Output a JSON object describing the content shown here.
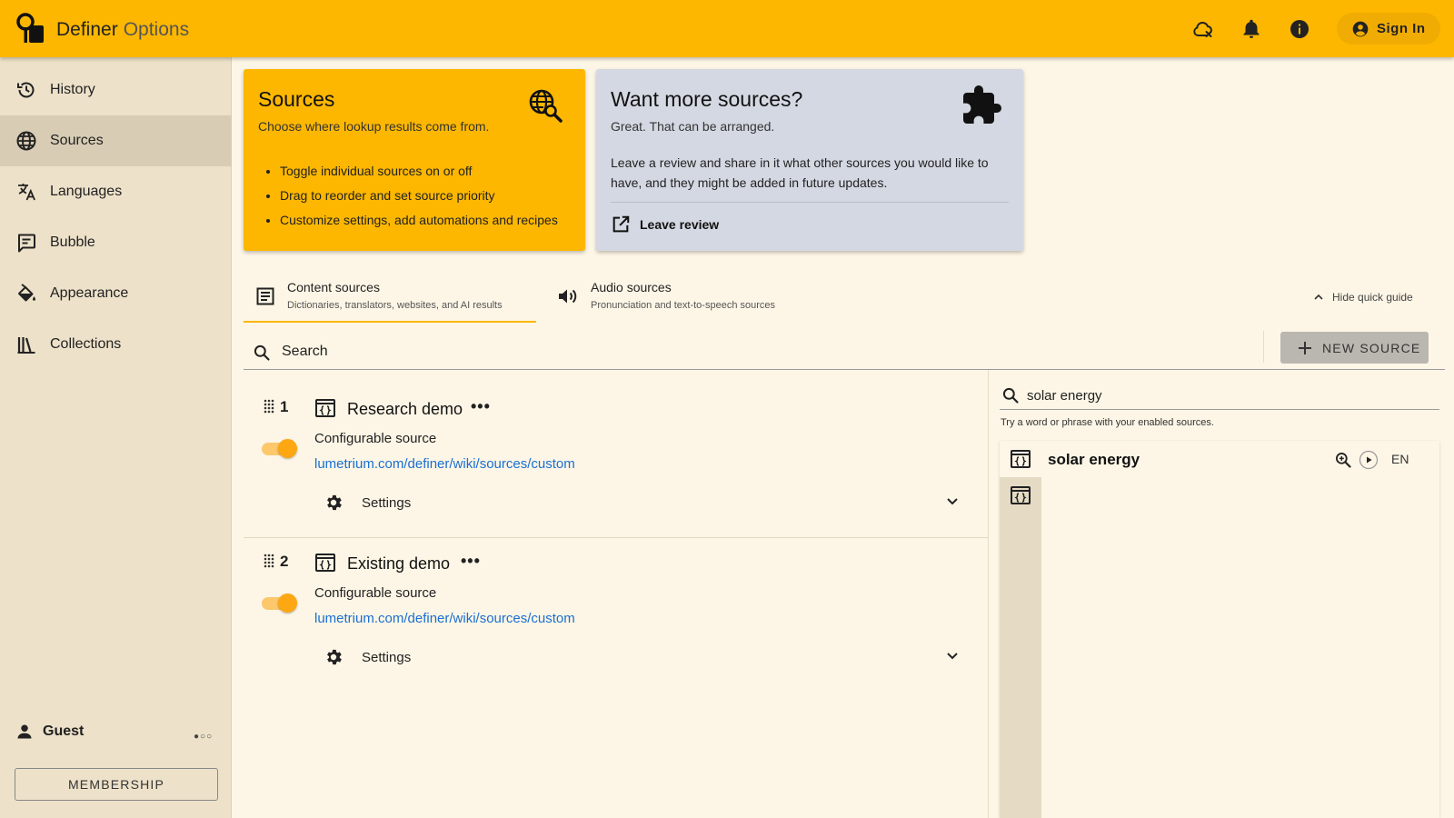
{
  "header": {
    "brand": "Definer",
    "brand_suffix": "Options",
    "icons": [
      "cloud-off-icon",
      "bell-icon",
      "info-icon"
    ],
    "sign_in_label": "Sign In"
  },
  "sidebar": {
    "items": [
      {
        "label": "History",
        "icon": "history-icon",
        "active": false
      },
      {
        "label": "Sources",
        "icon": "globe-icon",
        "active": true
      },
      {
        "label": "Languages",
        "icon": "translate-icon",
        "active": false
      },
      {
        "label": "Bubble",
        "icon": "comment-icon",
        "active": false
      },
      {
        "label": "Appearance",
        "icon": "paint-bucket-icon",
        "active": false
      },
      {
        "label": "Collections",
        "icon": "library-icon",
        "active": false
      }
    ],
    "user_name": "Guest",
    "user_menu": "●○○",
    "membership_label": "MEMBERSHIP"
  },
  "quick_guide": {
    "sources_card": {
      "title": "Sources",
      "subtitle": "Choose where lookup results come from.",
      "bullets": [
        "Toggle individual sources on or off",
        "Drag to reorder and set source priority",
        "Customize settings, add automations and recipes"
      ],
      "color": "#fdb700"
    },
    "more_card": {
      "title": "Want more sources?",
      "subtitle": "Great. That can be arranged.",
      "body": "Leave a review and share in it what other sources you would like to have, and they might be added in future updates.",
      "action_label": "Leave review",
      "color": "#d4d8e2"
    }
  },
  "tabs": [
    {
      "title": "Content sources",
      "subtitle": "Dictionaries, translators, websites, and AI results",
      "active": true
    },
    {
      "title": "Audio sources",
      "subtitle": "Pronunciation and text-to-speech sources",
      "active": false
    }
  ],
  "hide_guide_label": "Hide quick guide",
  "search": {
    "placeholder": "Search",
    "value": ""
  },
  "new_source_label": "NEW SOURCE",
  "sources": [
    {
      "order": "1",
      "name": "Research demo",
      "menu": "•••",
      "type": "Configurable source",
      "link": "lumetrium.com/definer/wiki/sources/custom",
      "enabled": true,
      "settings_label": "Settings"
    },
    {
      "order": "2",
      "name": "Existing demo",
      "menu": "•••",
      "type": "Configurable source",
      "link": "lumetrium.com/definer/wiki/sources/custom",
      "enabled": true,
      "settings_label": "Settings"
    }
  ],
  "preview": {
    "query": "solar energy",
    "hint": "Try a word or phrase with your enabled sources.",
    "word": "solar energy",
    "lang": "EN"
  },
  "colors": {
    "accent": "#fdb700",
    "sidebar": "#ede1c9",
    "link": "#1a6fd1"
  }
}
